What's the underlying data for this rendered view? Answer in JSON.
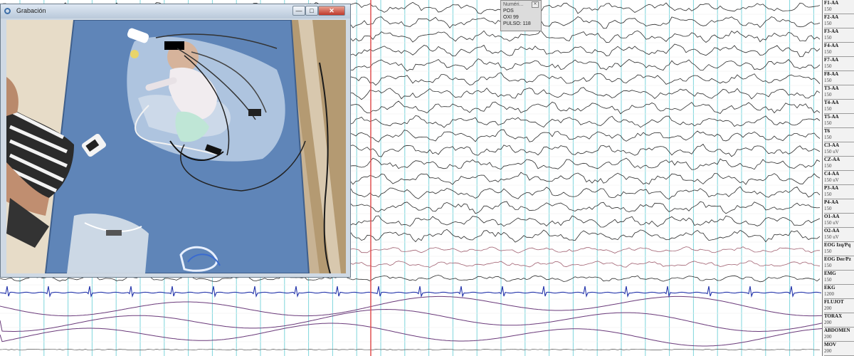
{
  "window": {
    "title": "Grabación",
    "minimize_symbol": "—",
    "maximize_symbol": "□",
    "close_symbol": "✕",
    "icon": "app-circle-icon"
  },
  "numeric_panel": {
    "title": "Numéri...",
    "close_symbol": "✕",
    "lines": [
      "POS",
      "OXI 99",
      "PULSO: 118"
    ]
  },
  "channels": [
    {
      "name": "F1-AA",
      "gain": "150"
    },
    {
      "name": "F2-AA",
      "gain": "150"
    },
    {
      "name": "F3-AA",
      "gain": "150"
    },
    {
      "name": "F4-AA",
      "gain": "150"
    },
    {
      "name": "F7-AA",
      "gain": "150"
    },
    {
      "name": "F8-AA",
      "gain": "150"
    },
    {
      "name": "T3-AA",
      "gain": "150"
    },
    {
      "name": "T4-AA",
      "gain": "150"
    },
    {
      "name": "T5-AA",
      "gain": "150"
    },
    {
      "name": "T6",
      "gain": "150"
    },
    {
      "name": "C3-AA",
      "gain": "150 uV"
    },
    {
      "name": "CZ-AA",
      "gain": "150"
    },
    {
      "name": "C4-AA",
      "gain": "150 uV"
    },
    {
      "name": "P3-AA",
      "gain": "150"
    },
    {
      "name": "P4-AA",
      "gain": "150"
    },
    {
      "name": "O1-AA",
      "gain": "150 uV"
    },
    {
      "name": "O2-AA",
      "gain": "150 uV"
    },
    {
      "name": "EOG Izq/Pq",
      "gain": "150"
    },
    {
      "name": "EOG Der/Pz",
      "gain": "150"
    },
    {
      "name": "EMG",
      "gain": "150"
    },
    {
      "name": "EKG",
      "gain": "1200"
    },
    {
      "name": "FLUJOT",
      "gain": "200"
    },
    {
      "name": "TORAX",
      "gain": "200"
    },
    {
      "name": "ABDOMEN",
      "gain": "200"
    },
    {
      "name": "MOV",
      "gain": "200"
    }
  ],
  "colors": {
    "grid": "#7fd6dc",
    "cursor": "#e05050",
    "eeg": "#2b2b2b",
    "eog": "#a06070",
    "ekg": "#2233aa",
    "resp": "#6a3a7a",
    "window_chrome": "#c9d6e4"
  }
}
